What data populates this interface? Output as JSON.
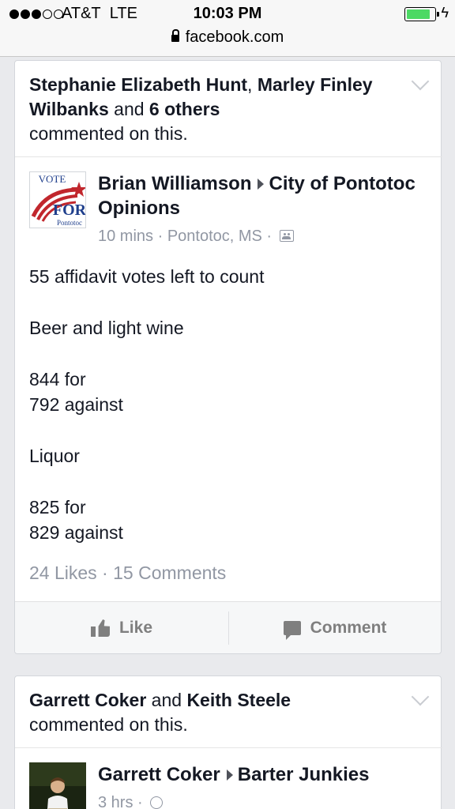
{
  "status_bar": {
    "carrier": "AT&T",
    "network": "LTE",
    "time": "10:03 PM",
    "signal_bars": 3,
    "signal_total": 5,
    "battery_level": 0.85,
    "battery_color": "#4cd964",
    "charging_icon": "bolt-icon"
  },
  "browser": {
    "url": "facebook.com",
    "secure_icon": "lock-icon"
  },
  "story1": {
    "name_a": "Stephanie Elizabeth Hunt",
    "sep1": ", ",
    "name_b": "Marley Finley Wilbanks",
    "and": " and ",
    "others": "6 others",
    "action": "commented on this.",
    "post": {
      "avatar_text_top": "VOTE",
      "avatar_text_mid": "FOR",
      "avatar_text_bottom": "Pontotoc",
      "author": "Brian Williamson",
      "target": "City of Pontotoc Opinions",
      "time": "10 mins",
      "location": "Pontotoc, MS",
      "dot": " · ",
      "lines": [
        "55 affidavit votes left to count",
        "Beer and light wine",
        "844 for",
        "792 against",
        "Liquor",
        "825 for",
        "829 against"
      ],
      "likes": "24 Likes",
      "comments": "15 Comments",
      "stats_sep": " · "
    },
    "like_label": "Like",
    "comment_label": "Comment"
  },
  "story2": {
    "name_a": "Garrett Coker",
    "and": " and ",
    "name_b": "Keith Steele",
    "action": "commented on this.",
    "post": {
      "author": "Garrett Coker",
      "target": "Barter Junkies",
      "time": "3 hrs",
      "dot": " · "
    }
  },
  "colors": {
    "background": "#e9eaed",
    "text": "#141823",
    "meta": "#9197a3",
    "action": "#7f7f7f"
  }
}
